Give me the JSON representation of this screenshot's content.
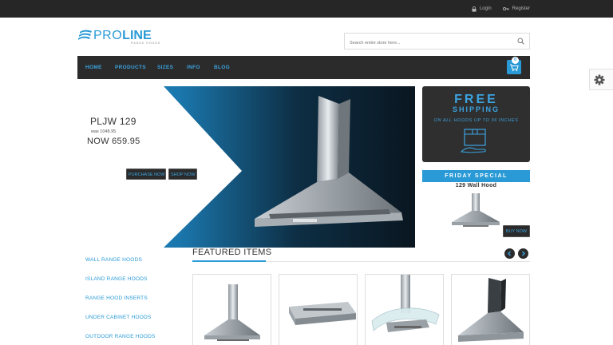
{
  "topbar": {
    "login": "Login",
    "register": "Register"
  },
  "logo": {
    "pro": "PRO",
    "line": "LINE",
    "tagline": "RANGE HOODS"
  },
  "search": {
    "placeholder": "Search entire store here..."
  },
  "nav": {
    "items": [
      "HOME",
      "PRODUCTS",
      "SIZES",
      "INFO",
      "BLOG"
    ],
    "cart_count": "0"
  },
  "banner": {
    "model": "PLJW 129",
    "was_price": "was 1048.95",
    "now_price": "NOW 659.95",
    "purchase_label": "PURCHASE NOW",
    "shop_label": "SHOP NOW"
  },
  "shipping": {
    "free": "FREE",
    "shipping": "SHIPPING",
    "subtitle": "ON ALL HOODS UP TO 36 INCHES"
  },
  "friday": {
    "title": "FRIDAY SPECIAL",
    "product": "129 Wall Hood",
    "buy_label": "BUY NOW"
  },
  "categories": [
    "WALL RANGE HOODS",
    "ISLAND RANGE HOODS",
    "RANGE HOOD INSERTS",
    "UNDER CABINET HOODS",
    "OUTDOOR RANGE HOODS"
  ],
  "featured": {
    "title": "FEATURED ITEMS"
  },
  "colors": {
    "accent": "#2a9ad6",
    "dark": "#2b2b2b",
    "topbar": "#262626"
  },
  "icons": [
    "lock-icon",
    "key-icon",
    "search-icon",
    "cart-icon",
    "gear-icon",
    "chevron-left-icon",
    "chevron-right-icon",
    "shipping-box-icon"
  ]
}
